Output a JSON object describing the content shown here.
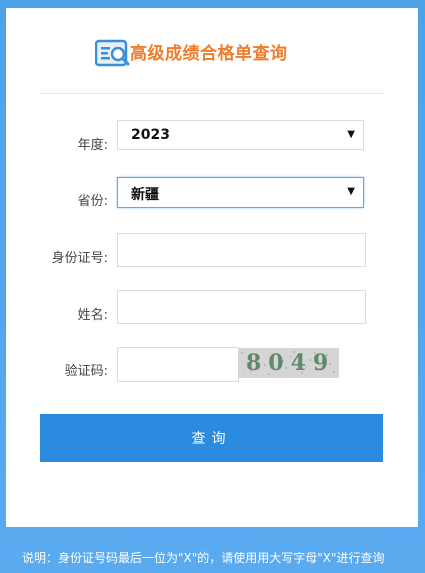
{
  "header": {
    "title": "高级成绩合格单查询",
    "logo_icon": "document-search-icon"
  },
  "form": {
    "year": {
      "label": "年度:",
      "value": "2023"
    },
    "province": {
      "label": "省份:",
      "value": "新疆"
    },
    "id_number": {
      "label": "身份证号:",
      "value": "",
      "placeholder": ""
    },
    "name": {
      "label": "姓名:",
      "value": "",
      "placeholder": ""
    },
    "captcha": {
      "label": "验证码:",
      "value": "",
      "placeholder": "",
      "image_text": "8049"
    },
    "submit_label": "查询"
  },
  "footer": {
    "note": "说明：身份证号码最后一位为\"X\"的，请使用用大写字母\"X\"进行查询"
  },
  "colors": {
    "background": "#4da2e6",
    "title": "#f07d2b",
    "button": "#2a8bdf"
  }
}
